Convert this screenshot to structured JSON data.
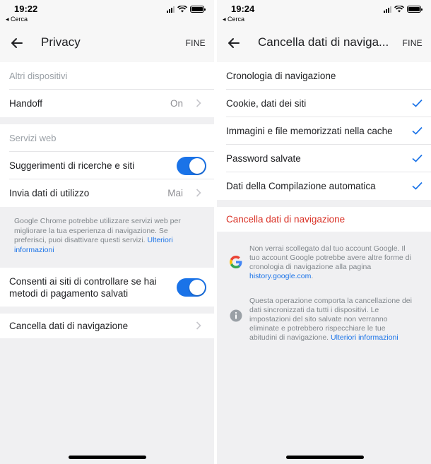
{
  "left": {
    "status": {
      "time": "19:22",
      "back_app": "◂ Cerca"
    },
    "nav": {
      "title": "Privacy",
      "done": "FINE"
    },
    "group1": {
      "header": "Altri dispositivi",
      "handoff": {
        "label": "Handoff",
        "value": "On"
      }
    },
    "group2": {
      "header": "Servizi web",
      "suggestions": {
        "label": "Suggerimenti di ricerche e siti",
        "on": true
      },
      "usage": {
        "label": "Invia dati di utilizzo",
        "value": "Mai"
      }
    },
    "footer": {
      "text": "Google Chrome potrebbe utilizzare servizi web per migliorare la tua esperienza di navigazione. Se preferisci, puoi disattivare questi servizi.",
      "link": "Ulteriori informazioni"
    },
    "payment": {
      "label": "Consenti ai siti di controllare se hai metodi di pagamento salvati",
      "on": true
    },
    "clear": {
      "label": "Cancella dati di navigazione"
    }
  },
  "right": {
    "status": {
      "time": "19:24",
      "back_app": "◂ Cerca"
    },
    "nav": {
      "title": "Cancella dati di naviga...",
      "done": "FINE"
    },
    "items": [
      {
        "label": "Cronologia di navigazione",
        "checked": false
      },
      {
        "label": "Cookie, dati dei siti",
        "checked": true
      },
      {
        "label": "Immagini e file memorizzati nella cache",
        "checked": true
      },
      {
        "label": "Password salvate",
        "checked": true
      },
      {
        "label": "Dati della Compilazione automatica",
        "checked": true
      }
    ],
    "clear_action": "Cancella dati di navigazione",
    "google_info": {
      "text": "Non verrai scollegato dal tuo account Google. Il tuo account Google potrebbe avere altre forme di cronologia di navigazione alla pagina",
      "link": "history.google.com",
      "end": "."
    },
    "sync_info": {
      "text": "Questa operazione comporta la cancellazione dei dati sincronizzati da tutti i dispositivi. Le impostazioni del sito salvate non verranno eliminate e potrebbero rispecchiare le tue abitudini di navigazione.",
      "link": "Ulteriori informazioni"
    }
  },
  "colors": {
    "accent": "#1a73e8",
    "destructive": "#d93025",
    "background": "#f0f0f2"
  },
  "icons": [
    "back-arrow-icon",
    "chevron-right-icon",
    "checkmark-icon",
    "google-g-icon",
    "info-icon",
    "wifi-icon",
    "battery-icon",
    "signal-icon"
  ]
}
